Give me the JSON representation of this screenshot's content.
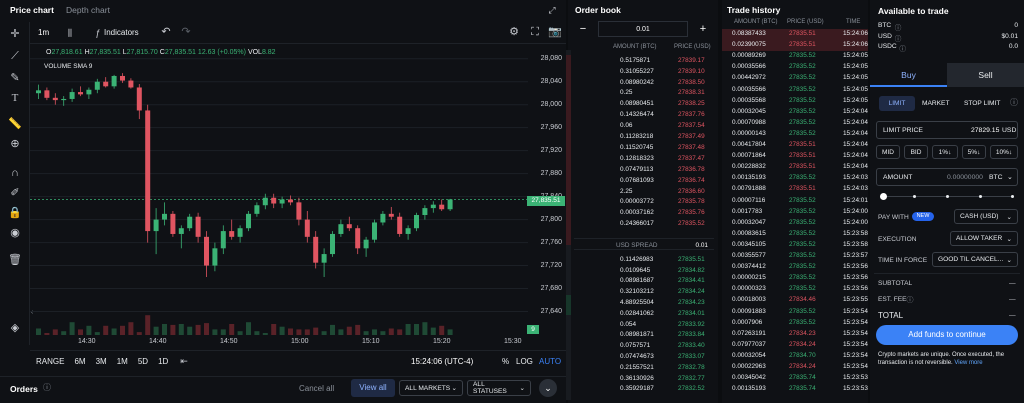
{
  "tabs": {
    "price_chart": "Price chart",
    "depth_chart": "Depth chart"
  },
  "chart": {
    "interval": "1m",
    "indicators_label": "Indicators",
    "ohlc": {
      "o_label": "O",
      "o": "27,818.61",
      "h_label": "H",
      "h": "27,835.51",
      "l_label": "L",
      "l": "27,815.70",
      "c_label": "C",
      "c": "27,835.51",
      "chg": "12.63 (+0.05%)",
      "vol_label": "VOL",
      "vol": "8.82"
    },
    "volume_sma": "VOLUME SMA 9",
    "y_ticks": [
      "28,080",
      "28,040",
      "28,000",
      "27,960",
      "27,920",
      "27,880",
      "27,840",
      "27,800",
      "27,760",
      "27,720",
      "27,680",
      "27,640"
    ],
    "x_ticks": [
      "14:30",
      "14:40",
      "14:50",
      "15:00",
      "15:10",
      "15:20",
      "15:30"
    ],
    "price_label": "27,835.51",
    "vol_label_box": "9",
    "ranges": [
      "RANGE",
      "6M",
      "3M",
      "1M",
      "5D",
      "1D"
    ],
    "time": "15:24:06 (UTC-4)",
    "pct": "%",
    "log": "LOG",
    "auto": "AUTO"
  },
  "chart_data": {
    "type": "candlestick",
    "y_range": [
      27620,
      28090
    ],
    "candles": [
      [
        28020,
        28035,
        28010,
        28025
      ],
      [
        28025,
        28030,
        28008,
        28012
      ],
      [
        28012,
        28020,
        28000,
        28008
      ],
      [
        28008,
        28015,
        27998,
        28010
      ],
      [
        28010,
        28028,
        28005,
        28022
      ],
      [
        28022,
        28032,
        28015,
        28018
      ],
      [
        28018,
        28030,
        28010,
        28026
      ],
      [
        28026,
        28045,
        28020,
        28040
      ],
      [
        28040,
        28048,
        28030,
        28032
      ],
      [
        28032,
        28052,
        28028,
        28050
      ],
      [
        28050,
        28055,
        28038,
        28042
      ],
      [
        28042,
        28046,
        28028,
        28030
      ],
      [
        28030,
        28036,
        27975,
        27990
      ],
      [
        27990,
        28000,
        27760,
        27780
      ],
      [
        27780,
        27820,
        27740,
        27800
      ],
      [
        27800,
        27830,
        27790,
        27810
      ],
      [
        27810,
        27815,
        27770,
        27775
      ],
      [
        27775,
        27790,
        27750,
        27785
      ],
      [
        27785,
        27810,
        27780,
        27805
      ],
      [
        27805,
        27812,
        27760,
        27770
      ],
      [
        27770,
        27780,
        27700,
        27720
      ],
      [
        27720,
        27760,
        27710,
        27750
      ],
      [
        27750,
        27790,
        27740,
        27780
      ],
      [
        27780,
        27800,
        27765,
        27770
      ],
      [
        27770,
        27790,
        27760,
        27785
      ],
      [
        27785,
        27815,
        27780,
        27810
      ],
      [
        27810,
        27830,
        27805,
        27825
      ],
      [
        27825,
        27845,
        27818,
        27838
      ],
      [
        27838,
        27845,
        27820,
        27828
      ],
      [
        27828,
        27840,
        27820,
        27835
      ],
      [
        27835,
        27842,
        27825,
        27830
      ],
      [
        27830,
        27838,
        27790,
        27800
      ],
      [
        27800,
        27815,
        27760,
        27770
      ],
      [
        27770,
        27780,
        27715,
        27725
      ],
      [
        27725,
        27750,
        27700,
        27740
      ],
      [
        27740,
        27780,
        27735,
        27775
      ],
      [
        27775,
        27800,
        27770,
        27792
      ],
      [
        27792,
        27805,
        27780,
        27785
      ],
      [
        27785,
        27790,
        27740,
        27750
      ],
      [
        27750,
        27770,
        27735,
        27765
      ],
      [
        27765,
        27800,
        27760,
        27795
      ],
      [
        27795,
        27815,
        27790,
        27810
      ],
      [
        27810,
        27822,
        27800,
        27805
      ],
      [
        27805,
        27812,
        27770,
        27775
      ],
      [
        27775,
        27790,
        27765,
        27785
      ],
      [
        27785,
        27812,
        27780,
        27808
      ],
      [
        27808,
        27825,
        27800,
        27820
      ],
      [
        27820,
        27832,
        27812,
        27826
      ],
      [
        27826,
        27835,
        27815,
        27818
      ],
      [
        27818,
        27836,
        27815,
        27835
      ]
    ]
  },
  "orders": {
    "title": "Orders",
    "cancel_all": "Cancel all",
    "view_all": "View all",
    "markets": "ALL MARKETS",
    "statuses": "ALL STATUSES"
  },
  "order_book": {
    "title": "Order book",
    "step": "0.01",
    "col_amount": "AMOUNT (BTC)",
    "col_price": "PRICE (USD)",
    "asks": [
      [
        "0.5175871",
        "27839.17"
      ],
      [
        "0.31055227",
        "27839.10"
      ],
      [
        "0.08980242",
        "27838.50"
      ],
      [
        "0.25",
        "27838.31"
      ],
      [
        "0.08980451",
        "27838.25"
      ],
      [
        "0.14326474",
        "27837.76"
      ],
      [
        "0.06",
        "27837.54"
      ],
      [
        "0.11283218",
        "27837.49"
      ],
      [
        "0.11520745",
        "27837.48"
      ],
      [
        "0.12818323",
        "27837.47"
      ],
      [
        "0.07479113",
        "27836.78"
      ],
      [
        "0.07681093",
        "27836.74"
      ],
      [
        "2.25",
        "27836.60"
      ],
      [
        "0.00003772",
        "27835.78"
      ],
      [
        "0.00037162",
        "27835.76"
      ],
      [
        "0.24366017",
        "27835.52"
      ]
    ],
    "spread_label": "USD SPREAD",
    "spread": "0.01",
    "bids": [
      [
        "0.11426983",
        "27835.51"
      ],
      [
        "0.0109645",
        "27834.82"
      ],
      [
        "0.08981687",
        "27834.41"
      ],
      [
        "0.32103212",
        "27834.24"
      ],
      [
        "4.88925504",
        "27834.23"
      ],
      [
        "0.02841062",
        "27834.01"
      ],
      [
        "0.054",
        "27833.92"
      ],
      [
        "0.08981871",
        "27833.84"
      ],
      [
        "0.0757571",
        "27833.40"
      ],
      [
        "0.07474673",
        "27833.07"
      ],
      [
        "0.21557521",
        "27832.78"
      ],
      [
        "0.36130926",
        "27832.77"
      ],
      [
        "0.35929187",
        "27832.52"
      ]
    ]
  },
  "trade_history": {
    "title": "Trade history",
    "col_amount": "AMOUNT (BTC)",
    "col_price": "PRICE (USD)",
    "col_time": "TIME",
    "rows": [
      [
        "0.08387433",
        "27835.51",
        "15:24:06",
        "s"
      ],
      [
        "0.02390075",
        "27835.51",
        "15:24:06",
        "s"
      ],
      [
        "0.00089269",
        "27835.52",
        "15:24:05",
        "b"
      ],
      [
        "0.00035566",
        "27835.52",
        "15:24:05",
        "b"
      ],
      [
        "0.00442972",
        "27835.52",
        "15:24:05",
        "b"
      ],
      [
        "0.00035566",
        "27835.52",
        "15:24:05",
        "b"
      ],
      [
        "0.00035568",
        "27835.52",
        "15:24:05",
        "b"
      ],
      [
        "0.00032045",
        "27835.52",
        "15:24:04",
        "b"
      ],
      [
        "0.00070988",
        "27835.52",
        "15:24:04",
        "b"
      ],
      [
        "0.00000143",
        "27835.52",
        "15:24:04",
        "b"
      ],
      [
        "0.00417804",
        "27835.51",
        "15:24:04",
        "s"
      ],
      [
        "0.00071864",
        "27835.51",
        "15:24:04",
        "s"
      ],
      [
        "0.00228832",
        "27835.51",
        "15:24:04",
        "s"
      ],
      [
        "0.00135193",
        "27835.52",
        "15:24:03",
        "b"
      ],
      [
        "0.00791888",
        "27835.51",
        "15:24:03",
        "s"
      ],
      [
        "0.00007116",
        "27835.52",
        "15:24:01",
        "b"
      ],
      [
        "0.0017783",
        "27835.52",
        "15:24:00",
        "b"
      ],
      [
        "0.00032047",
        "27835.52",
        "15:24:00",
        "b"
      ],
      [
        "0.00083615",
        "27835.52",
        "15:23:58",
        "b"
      ],
      [
        "0.00345105",
        "27835.52",
        "15:23:58",
        "b"
      ],
      [
        "0.00355577",
        "27835.52",
        "15:23:57",
        "b"
      ],
      [
        "0.00374412",
        "27835.52",
        "15:23:56",
        "b"
      ],
      [
        "0.00000215",
        "27835.52",
        "15:23:56",
        "b"
      ],
      [
        "0.00000323",
        "27835.52",
        "15:23:56",
        "b"
      ],
      [
        "0.00018003",
        "27834.46",
        "15:23:55",
        "s"
      ],
      [
        "0.00091883",
        "27835.52",
        "15:23:54",
        "b"
      ],
      [
        "0.0007906",
        "27835.52",
        "15:23:54",
        "b"
      ],
      [
        "0.07263191",
        "27834.23",
        "15:23:54",
        "s"
      ],
      [
        "0.07977037",
        "27834.24",
        "15:23:54",
        "s"
      ],
      [
        "0.00032054",
        "27834.70",
        "15:23:54",
        "b"
      ],
      [
        "0.00022963",
        "27834.24",
        "15:23:54",
        "s"
      ],
      [
        "0.00345042",
        "27835.74",
        "15:23:53",
        "b"
      ],
      [
        "0.00135193",
        "27835.74",
        "15:23:53",
        "b"
      ]
    ]
  },
  "trade": {
    "title": "Available to trade",
    "balances": [
      [
        "BTC",
        "0"
      ],
      [
        "USD",
        "$0.01"
      ],
      [
        "USDC",
        "0.0"
      ]
    ],
    "buy": "Buy",
    "sell": "Sell",
    "order_types": [
      "LIMIT",
      "MARKET",
      "STOP LIMIT"
    ],
    "limit_price_label": "LIMIT PRICE",
    "limit_price": "27829.15",
    "limit_price_unit": "USD",
    "quick": [
      "MID",
      "BID",
      "1%↓",
      "5%↓",
      "10%↓"
    ],
    "amount_label": "AMOUNT",
    "amount": "0.00000000",
    "amount_unit": "BTC",
    "pay_with_label": "PAY WITH",
    "new_badge": "NEW",
    "pay_with": "CASH (USD)",
    "execution_label": "EXECUTION",
    "execution": "ALLOW TAKER",
    "tif_label": "TIME IN FORCE",
    "tif": "GOOD TIL CANCEL...",
    "subtotal_label": "SUBTOTAL",
    "fee_label": "EST. FEE",
    "total_label": "TOTAL",
    "dash": "—",
    "funds_button": "Add funds to continue",
    "note": "Crypto markets are unique. Once executed, the transaction is not reversible.",
    "view_more": "View more"
  }
}
